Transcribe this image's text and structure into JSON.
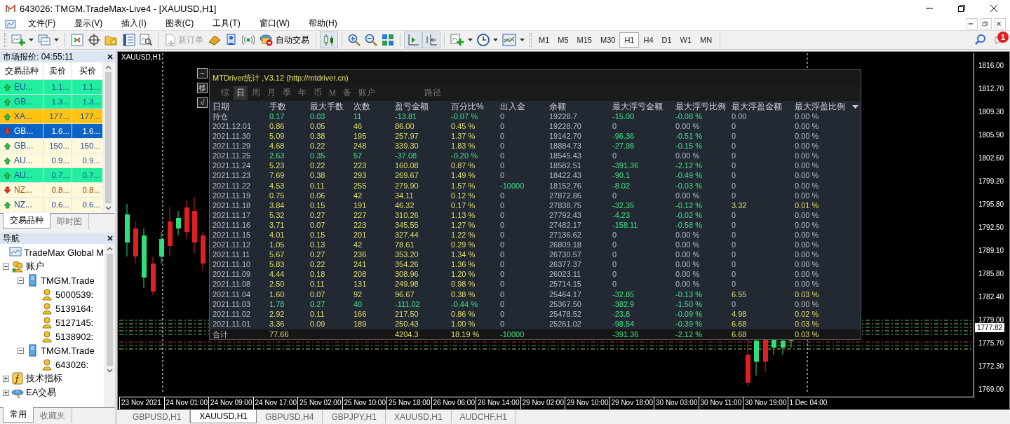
{
  "window": {
    "title": "643026: TMGM.TradeMax-Live4 - [XAUUSD,H1]"
  },
  "menu": [
    "文件(F)",
    "显示(V)",
    "插入(I)",
    "图表(C)",
    "工具(T)",
    "窗口(W)",
    "帮助(H)"
  ],
  "toolbar": {
    "new_order": {
      "label": "新订单",
      "disabled": true
    },
    "auto_trading": {
      "label": "自动交易"
    },
    "timeframes": [
      {
        "label": "M1",
        "selected": false
      },
      {
        "label": "M5",
        "selected": false
      },
      {
        "label": "M15",
        "selected": false
      },
      {
        "label": "M30",
        "selected": false
      },
      {
        "label": "H1",
        "selected": true
      },
      {
        "label": "H4",
        "selected": false
      },
      {
        "label": "D1",
        "selected": false
      },
      {
        "label": "W1",
        "selected": false
      },
      {
        "label": "MN",
        "selected": false
      }
    ],
    "notification_count": "1"
  },
  "market_watch": {
    "title": "市场报价: 04:55:11",
    "columns": [
      "交易品种",
      "卖价",
      "买价"
    ],
    "rows": [
      {
        "symbol": "EU...",
        "bid": "1.1...",
        "ask": "1.1...",
        "kind": "up",
        "color": "#22eea0",
        "selected": false
      },
      {
        "symbol": "GB...",
        "bid": "1.3...",
        "ask": "1.3...",
        "kind": "up",
        "color": "#22eea0",
        "selected": false
      },
      {
        "symbol": "XA...",
        "bid": "177...",
        "ask": "177...",
        "kind": "up",
        "color": "#ffc20e",
        "selected": false
      },
      {
        "symbol": "GB...",
        "bid": "1.6...",
        "ask": "1.6...",
        "kind": "down",
        "color": "#0a64c8",
        "selected": true
      },
      {
        "symbol": "GB...",
        "bid": "150...",
        "ask": "150...",
        "kind": "up",
        "color": "#fff9dc",
        "selected": false
      },
      {
        "symbol": "AU...",
        "bid": "0.9...",
        "ask": "0.9...",
        "kind": "up",
        "color": "#fff9dc",
        "selected": false
      },
      {
        "symbol": "AU...",
        "bid": "0.7...",
        "ask": "0.7...",
        "kind": "up",
        "color": "#22eea0",
        "selected": false
      },
      {
        "symbol": "NZ...",
        "bid": "0.8...",
        "ask": "0.8...",
        "kind": "down",
        "color": "#fff9dc",
        "selected": false
      },
      {
        "symbol": "NZ...",
        "bid": "0.6...",
        "ask": "0.6...",
        "kind": "up",
        "color": "#fff9dc",
        "selected": false
      }
    ],
    "tabs": [
      {
        "label": "交易品种",
        "selected": true
      },
      {
        "label": "即时图",
        "selected": false
      }
    ]
  },
  "navigator": {
    "title": "导航",
    "tree": [
      {
        "label": "TradeMax Global M",
        "kind": "terminal"
      },
      {
        "label": "账户",
        "kind": "accounts",
        "expanded": true,
        "children": [
          {
            "label": "TMGM.Trade",
            "kind": "server",
            "expanded": true,
            "children": [
              {
                "label": "5000539:",
                "kind": "account"
              },
              {
                "label": "5139164:",
                "kind": "account"
              },
              {
                "label": "5127145:",
                "kind": "account"
              },
              {
                "label": "5138902:",
                "kind": "account"
              }
            ]
          },
          {
            "label": "TMGM.Trade",
            "kind": "server",
            "expanded": true,
            "children": [
              {
                "label": "643026:",
                "kind": "account"
              }
            ]
          }
        ]
      },
      {
        "label": "技术指标",
        "kind": "indicators",
        "expanded": false
      },
      {
        "label": "EA交易",
        "kind": "experts",
        "expanded": false
      }
    ],
    "tabs": [
      {
        "label": "常用",
        "selected": true
      },
      {
        "label": "收藏夹",
        "selected": false
      }
    ]
  },
  "chart": {
    "title": "XAUUSD,H1",
    "price_labels": [
      "1816.00",
      "1812.70",
      "1809.30",
      "1805.90",
      "1802.60",
      "1799.20",
      "1795.80",
      "1792.50",
      "1789.10",
      "1785.80",
      "1782.40",
      "1779.00",
      "1775.70",
      "1772.30",
      "1769.00"
    ],
    "current_price": "1777.82",
    "time_labels": [
      "23 Nov 2021",
      "24 Nov 01:00",
      "24 Nov 09:00",
      "24 Nov 17:00",
      "25 Nov 02:00",
      "25 Nov 10:00",
      "25 Nov 18:00",
      "26 Nov 06:00",
      "26 Nov 14:00",
      "29 Nov 02:00",
      "29 Nov 10:00",
      "29 Nov 18:00",
      "30 Nov 03:00",
      "30 Nov 11:00",
      "30 Nov 19:00",
      "1 Dec 04:00"
    ]
  },
  "stats_panel": {
    "side_buttons": [
      "−",
      "移",
      "√"
    ],
    "title": "MTDriver统计 ,V3.12 (http://mtdriver.cn)",
    "tabs": [
      {
        "label": "综",
        "selected": false
      },
      {
        "label": "日",
        "selected": true
      },
      {
        "label": "周",
        "selected": false
      },
      {
        "label": "月",
        "selected": false
      },
      {
        "label": "季",
        "selected": false
      },
      {
        "label": "年",
        "selected": false
      },
      {
        "label": "币",
        "selected": false
      },
      {
        "label": "M",
        "selected": false
      },
      {
        "label": "备",
        "selected": false
      },
      {
        "label": "账户",
        "selected": false
      }
    ],
    "path_button": "路径",
    "columns": [
      "日期",
      "手数",
      "最大手数",
      "次数",
      "盈亏金额",
      "百分比%",
      "出入金",
      "余额",
      "最大浮亏金额",
      "最大浮亏比例",
      "最大浮盈金额",
      "最大浮盈比例"
    ],
    "rows": [
      {
        "cells": [
          "持仓",
          "0.17",
          "0.03",
          "11",
          "-13.81",
          "-0.07 %",
          "0",
          "19228.7",
          "-15.00",
          "-0.08 %",
          "0.00",
          "0.00 %"
        ],
        "loss": true,
        "transfer": false,
        "float_loss": true,
        "float_profit": false
      },
      {
        "cells": [
          "2021.12.01",
          "0.86",
          "0.05",
          "46",
          "86.00",
          "0.45 %",
          "0",
          "19228.70",
          "0",
          "0.00 %",
          "0",
          "0.00 %"
        ],
        "loss": false,
        "transfer": false,
        "float_loss": false,
        "float_profit": false
      },
      {
        "cells": [
          "2021.11.30",
          "5.09",
          "0.38",
          "195",
          "257.97",
          "1.37 %",
          "0",
          "19142.70",
          "-96.36",
          "-0.51 %",
          "0",
          "0.00 %"
        ],
        "loss": false,
        "transfer": false,
        "float_loss": true,
        "float_profit": false
      },
      {
        "cells": [
          "2021.11.29",
          "4.68",
          "0.22",
          "248",
          "339.30",
          "1.83 %",
          "0",
          "18884.73",
          "-27.98",
          "-0.15 %",
          "0",
          "0.00 %"
        ],
        "loss": false,
        "transfer": false,
        "float_loss": true,
        "float_profit": false
      },
      {
        "cells": [
          "2021.11.25",
          "2.63",
          "0.35",
          "57",
          "-37.08",
          "-0.20 %",
          "0",
          "18545.43",
          "0",
          "0.00 %",
          "0",
          "0.00 %"
        ],
        "loss": true,
        "transfer": false,
        "float_loss": false,
        "float_profit": false
      },
      {
        "cells": [
          "2021.11.24",
          "5.23",
          "0.22",
          "223",
          "160.08",
          "0.87 %",
          "0",
          "18582.51",
          "-391.36",
          "-2.12 %",
          "0",
          "0.00 %"
        ],
        "loss": false,
        "transfer": false,
        "float_loss": true,
        "float_profit": false
      },
      {
        "cells": [
          "2021.11.23",
          "7.69",
          "0.38",
          "293",
          "269.67",
          "1.49 %",
          "0",
          "18422.43",
          "-90.1",
          "-0.49 %",
          "0",
          "0.00 %"
        ],
        "loss": false,
        "transfer": false,
        "float_loss": true,
        "float_profit": false
      },
      {
        "cells": [
          "2021.11.22",
          "4.53",
          "0.11",
          "255",
          "279.90",
          "1.57 %",
          "-10000",
          "18152.76",
          "-8.02",
          "-0.03 %",
          "0",
          "0.00 %"
        ],
        "loss": false,
        "transfer": true,
        "float_loss": true,
        "float_profit": false
      },
      {
        "cells": [
          "2021.11.19",
          "0.75",
          "0.06",
          "42",
          "34.11",
          "0.12 %",
          "0",
          "27872.86",
          "0",
          "0.00 %",
          "0",
          "0.00 %"
        ],
        "loss": false,
        "transfer": false,
        "float_loss": false,
        "float_profit": false
      },
      {
        "cells": [
          "2021.11.18",
          "3.84",
          "0.15",
          "191",
          "46.32",
          "0.17 %",
          "0",
          "27838.75",
          "-32.35",
          "-0.12 %",
          "3.32",
          "0.01 %"
        ],
        "loss": false,
        "transfer": false,
        "float_loss": true,
        "float_profit": true
      },
      {
        "cells": [
          "2021.11.17",
          "5.32",
          "0.27",
          "227",
          "310.26",
          "1.13 %",
          "0",
          "27792.43",
          "-4.23",
          "-0.02 %",
          "0",
          "0.00 %"
        ],
        "loss": false,
        "transfer": false,
        "float_loss": true,
        "float_profit": false
      },
      {
        "cells": [
          "2021.11.16",
          "3.71",
          "0.07",
          "223",
          "345.55",
          "1.27 %",
          "0",
          "27482.17",
          "-158.11",
          "-0.58 %",
          "0",
          "0.00 %"
        ],
        "loss": false,
        "transfer": false,
        "float_loss": true,
        "float_profit": false
      },
      {
        "cells": [
          "2021.11.15",
          "4.01",
          "0.15",
          "201",
          "327.44",
          "1.22 %",
          "0",
          "27136.62",
          "0",
          "0.00 %",
          "0",
          "0.00 %"
        ],
        "loss": false,
        "transfer": false,
        "float_loss": false,
        "float_profit": false
      },
      {
        "cells": [
          "2021.11.12",
          "1.05",
          "0.13",
          "42",
          "78.61",
          "0.29 %",
          "0",
          "26809.18",
          "0",
          "0.00 %",
          "0",
          "0.00 %"
        ],
        "loss": false,
        "transfer": false,
        "float_loss": false,
        "float_profit": false
      },
      {
        "cells": [
          "2021.11.11",
          "5.67",
          "0.27",
          "236",
          "353.20",
          "1.34 %",
          "0",
          "26730.57",
          "0",
          "0.00 %",
          "0",
          "0.00 %"
        ],
        "loss": false,
        "transfer": false,
        "float_loss": false,
        "float_profit": false
      },
      {
        "cells": [
          "2021.11.10",
          "5.83",
          "0.22",
          "241",
          "354.26",
          "1.36 %",
          "0",
          "26377.37",
          "0",
          "0.00 %",
          "0",
          "0.00 %"
        ],
        "loss": false,
        "transfer": false,
        "float_loss": false,
        "float_profit": false
      },
      {
        "cells": [
          "2021.11.09",
          "4.44",
          "0.18",
          "208",
          "308.96",
          "1.20 %",
          "0",
          "26023.11",
          "0",
          "0.00 %",
          "0",
          "0.00 %"
        ],
        "loss": false,
        "transfer": false,
        "float_loss": false,
        "float_profit": false
      },
      {
        "cells": [
          "2021.11.08",
          "2.50",
          "0.11",
          "131",
          "249.98",
          "0.98 %",
          "0",
          "25714.15",
          "0",
          "0.00 %",
          "0",
          "0.00 %"
        ],
        "loss": false,
        "transfer": false,
        "float_loss": false,
        "float_profit": false
      },
      {
        "cells": [
          "2021.11.04",
          "1.60",
          "0.07",
          "92",
          "96.67",
          "0.38 %",
          "0",
          "25464.17",
          "-32.85",
          "-0.13 %",
          "6.55",
          "0.03 %"
        ],
        "loss": false,
        "transfer": false,
        "float_loss": true,
        "float_profit": true
      },
      {
        "cells": [
          "2021.11.03",
          "1.78",
          "0.27",
          "40",
          "-111.02",
          "-0.44 %",
          "0",
          "25367.50",
          "-382.9",
          "-1.50 %",
          "0",
          "0.00 %"
        ],
        "loss": true,
        "transfer": false,
        "float_loss": true,
        "float_profit": false
      },
      {
        "cells": [
          "2021.11.02",
          "2.92",
          "0.11",
          "166",
          "217.50",
          "0.86 %",
          "0",
          "25478.52",
          "-23.8",
          "-0.09 %",
          "4.98",
          "0.02 %"
        ],
        "loss": false,
        "transfer": false,
        "float_loss": true,
        "float_profit": true
      },
      {
        "cells": [
          "2021.11.01",
          "3.36",
          "0.09",
          "189",
          "250.43",
          "1.00 %",
          "0",
          "25261.02",
          "-98.54",
          "-0.39 %",
          "6.68",
          "0.03 %"
        ],
        "loss": false,
        "transfer": false,
        "float_loss": true,
        "float_profit": true
      }
    ],
    "total": {
      "cells": [
        "合计",
        "77.66",
        null,
        null,
        "4204.3",
        "18.19 %",
        "-10000",
        null,
        "-391.36",
        "-2.12 %",
        "6.68",
        "0.03 %"
      ],
      "loss": false,
      "transfer": true,
      "float_loss": true,
      "float_profit": true
    }
  },
  "chart_tabs": [
    {
      "label": "GBPUSD,H1",
      "selected": false
    },
    {
      "label": "XAUUSD,H1",
      "selected": true
    },
    {
      "label": "GBPUSD,H4",
      "selected": false
    },
    {
      "label": "GBPJPY,H1",
      "selected": false
    },
    {
      "label": "XAUUSD,H1",
      "selected": false
    },
    {
      "label": "AUDCHF,H1",
      "selected": false
    }
  ]
}
